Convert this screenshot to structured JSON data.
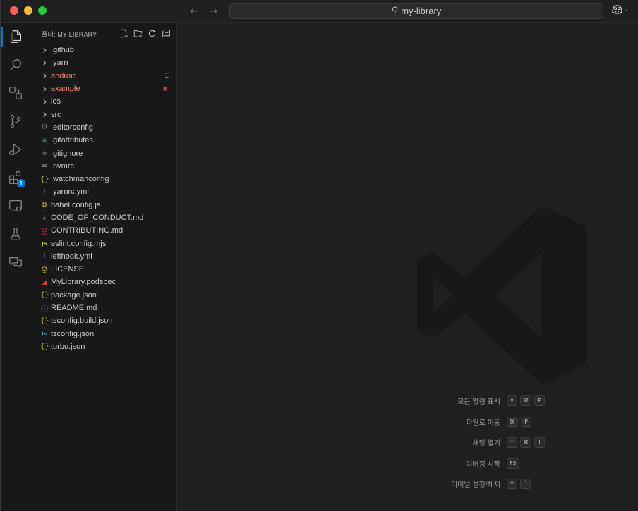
{
  "window": {
    "search_text": "my-library"
  },
  "activity_bar": {
    "items": [
      {
        "name": "explorer-icon",
        "active": true
      },
      {
        "name": "search-icon"
      },
      {
        "name": "source-control-graph-icon"
      },
      {
        "name": "source-control-icon"
      },
      {
        "name": "run-debug-icon"
      },
      {
        "name": "extensions-icon",
        "badge": "1"
      },
      {
        "name": "remote-explorer-icon"
      },
      {
        "name": "testing-icon"
      },
      {
        "name": "chat-icon"
      }
    ]
  },
  "explorer": {
    "title": "폴더: MY-LIBRARY",
    "actions": [
      "new-file-icon",
      "new-folder-icon",
      "refresh-icon",
      "collapse-all-icon"
    ],
    "items": [
      {
        "label": ".github",
        "type": "folder"
      },
      {
        "label": ".yarn",
        "type": "folder"
      },
      {
        "label": "android",
        "type": "folder",
        "modified": true,
        "decoration": "1"
      },
      {
        "label": "example",
        "type": "folder",
        "modified": true,
        "decoration": "dot"
      },
      {
        "label": "ios",
        "type": "folder"
      },
      {
        "label": "src",
        "type": "folder"
      },
      {
        "label": ".editorconfig",
        "type": "file",
        "icon": "gear-icon",
        "glyph": "⚙",
        "color": "#6d8086"
      },
      {
        "label": ".gitattributes",
        "type": "file",
        "icon": "git-icon",
        "glyph": "◆",
        "color": "#41535b"
      },
      {
        "label": ".gitignore",
        "type": "file",
        "icon": "git-icon",
        "glyph": "◆",
        "color": "#41535b"
      },
      {
        "label": ".nvmrc",
        "type": "file",
        "icon": "lines-icon",
        "glyph": "≡",
        "color": "#9d9d9d"
      },
      {
        "label": ".watchmanconfig",
        "type": "file",
        "icon": "json-icon",
        "glyph": "{}",
        "color": "#cbcb41"
      },
      {
        "label": ".yarnrc.yml",
        "type": "file",
        "icon": "yaml-icon",
        "glyph": "!",
        "color": "#a074c4"
      },
      {
        "label": "babel.config.js",
        "type": "file",
        "icon": "babel-icon",
        "glyph": "B",
        "color": "#cbcb41"
      },
      {
        "label": "CODE_OF_CONDUCT.md",
        "type": "file",
        "icon": "download-arrow-icon",
        "glyph": "↓",
        "color": "#519aba"
      },
      {
        "label": "CONTRIBUTING.md",
        "type": "file",
        "icon": "person-icon",
        "glyph": "웃",
        "color": "#cc3e44"
      },
      {
        "label": "eslint.config.mjs",
        "type": "file",
        "icon": "js-icon",
        "glyph": "JS",
        "color": "#cbcb41"
      },
      {
        "label": "lefthook.yml",
        "type": "file",
        "icon": "yaml-icon",
        "glyph": "!",
        "color": "#a074c4"
      },
      {
        "label": "LICENSE",
        "type": "file",
        "icon": "license-icon",
        "glyph": "웃",
        "color": "#cbcb41"
      },
      {
        "label": "MyLibrary.podspec",
        "type": "file",
        "icon": "ruby-icon",
        "glyph": "◢",
        "color": "#cc3e44"
      },
      {
        "label": "package.json",
        "type": "file",
        "icon": "json-icon",
        "glyph": "{}",
        "color": "#cbcb41"
      },
      {
        "label": "README.md",
        "type": "file",
        "icon": "info-icon",
        "glyph": "ⓘ",
        "color": "#519aba"
      },
      {
        "label": "tsconfig.build.json",
        "type": "file",
        "icon": "json-icon",
        "glyph": "{}",
        "color": "#cbcb41"
      },
      {
        "label": "tsconfig.json",
        "type": "file",
        "icon": "tsconfig-icon",
        "glyph": "ts",
        "color": "#519aba"
      },
      {
        "label": "turbo.json",
        "type": "file",
        "icon": "json-icon",
        "glyph": "{}",
        "color": "#cbcb41"
      }
    ]
  },
  "editor": {
    "shortcuts": [
      {
        "label": "모든 명령 표시",
        "keys": [
          "⇧",
          "⌘",
          "P"
        ]
      },
      {
        "label": "파일로 이동",
        "keys": [
          "⌘",
          "P"
        ]
      },
      {
        "label": "채팅 열기",
        "keys": [
          "^",
          "⌘",
          "I"
        ]
      },
      {
        "label": "디버깅 시작",
        "keys": [
          "F5"
        ]
      },
      {
        "label": "터미널 설정/해제",
        "keys": [
          "^",
          "`"
        ]
      }
    ]
  },
  "colors": {
    "accent": "#0078d4",
    "modified": "#f48771"
  }
}
